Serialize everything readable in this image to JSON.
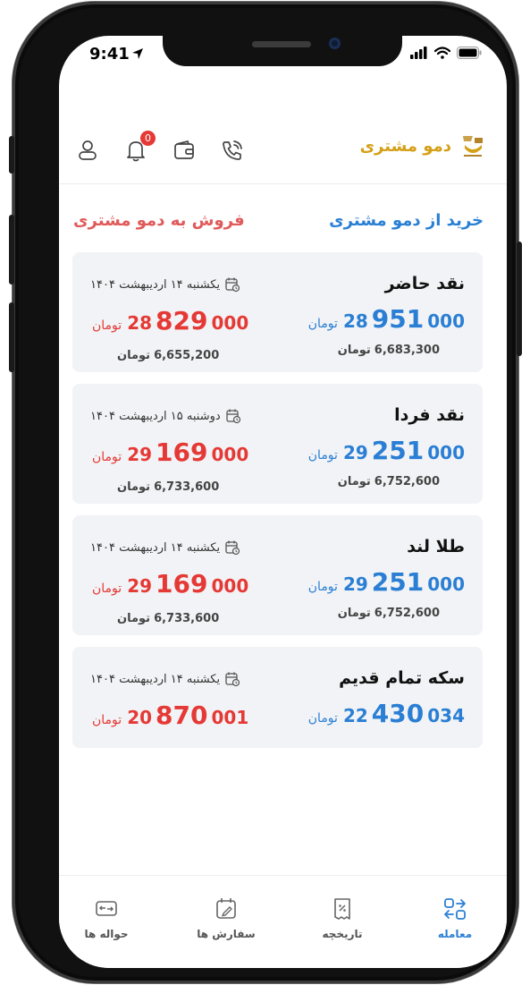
{
  "status": {
    "time": "9:41"
  },
  "header": {
    "brand_name": "دمو مشتری",
    "notification_count": "0"
  },
  "sections": {
    "buy_title": "خرید از دمو مشتری",
    "sell_title": "فروش به دمو مشتری"
  },
  "currency": "تومان",
  "items": [
    {
      "name": "نقد حاضر",
      "date": "یکشنبه ۱۴ اردیبهشت ۱۴۰۴",
      "buy": {
        "head": "28",
        "mid": "951",
        "tail": "000",
        "sub": "6,683,300"
      },
      "sell": {
        "head": "28",
        "mid": "829",
        "tail": "000",
        "sub": "6,655,200"
      }
    },
    {
      "name": "نقد فردا",
      "date": "دوشنبه ۱۵ اردیبهشت ۱۴۰۴",
      "buy": {
        "head": "29",
        "mid": "251",
        "tail": "000",
        "sub": "6,752,600"
      },
      "sell": {
        "head": "29",
        "mid": "169",
        "tail": "000",
        "sub": "6,733,600"
      }
    },
    {
      "name": "طلا لند",
      "date": "یکشنبه ۱۴ اردیبهشت ۱۴۰۴",
      "buy": {
        "head": "29",
        "mid": "251",
        "tail": "000",
        "sub": "6,752,600"
      },
      "sell": {
        "head": "29",
        "mid": "169",
        "tail": "000",
        "sub": "6,733,600"
      }
    },
    {
      "name": "سکه تمام قدیم",
      "date": "یکشنبه ۱۴ اردیبهشت ۱۴۰۴",
      "buy": {
        "head": "22",
        "mid": "430",
        "tail": "034",
        "sub": ""
      },
      "sell": {
        "head": "20",
        "mid": "870",
        "tail": "001",
        "sub": ""
      }
    }
  ],
  "nav": {
    "trade": "معامله",
    "history": "تاریخچه",
    "orders": "سفارش ها",
    "transfers": "حواله ها"
  },
  "colors": {
    "buy": "#2a7fd4",
    "sell": "#e53935",
    "brand": "#d4a017",
    "card_bg": "#f2f3f6"
  }
}
